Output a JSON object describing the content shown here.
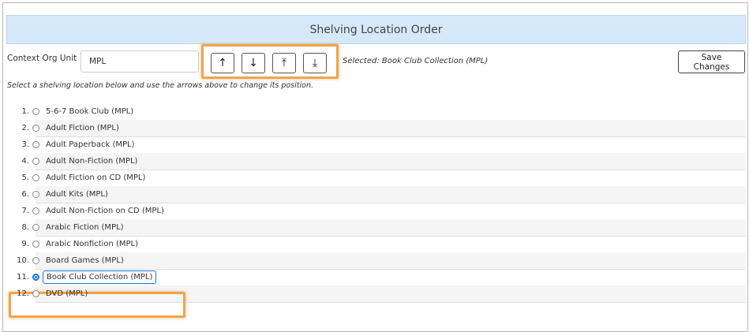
{
  "header": {
    "title": "Shelving Location Order"
  },
  "context": {
    "label": "Context Org Unit",
    "value": "MPL"
  },
  "arrows": [
    {
      "name": "move-up-icon",
      "glyph": "↑"
    },
    {
      "name": "move-down-icon",
      "glyph": "↓"
    },
    {
      "name": "move-to-top-icon",
      "glyph": "⤒"
    },
    {
      "name": "move-to-bottom-icon",
      "glyph": "⤓"
    }
  ],
  "selected_text": "Selected: Book Club Collection (MPL)",
  "save_label": "Save Changes",
  "instructions": "Select a shelving location below and use the arrows above to change its position.",
  "locations": [
    {
      "num": "1.",
      "label": "5-6-7 Book Club (MPL)",
      "checked": false
    },
    {
      "num": "2.",
      "label": "Adult Fiction (MPL)",
      "checked": false
    },
    {
      "num": "3.",
      "label": "Adult Paperback (MPL)",
      "checked": false
    },
    {
      "num": "4.",
      "label": "Adult Non-Fiction (MPL)",
      "checked": false
    },
    {
      "num": "5.",
      "label": "Adult Fiction on CD (MPL)",
      "checked": false
    },
    {
      "num": "6.",
      "label": "Adult Kits (MPL)",
      "checked": false
    },
    {
      "num": "7.",
      "label": "Adult Non-Fiction on CD (MPL)",
      "checked": false
    },
    {
      "num": "8.",
      "label": "Arabic Fiction (MPL)",
      "checked": false
    },
    {
      "num": "9.",
      "label": "Arabic Nonfiction (MPL)",
      "checked": false
    },
    {
      "num": "10.",
      "label": "Board Games (MPL)",
      "checked": false
    },
    {
      "num": "11.",
      "label": "Book Club Collection (MPL)",
      "checked": true
    },
    {
      "num": "12.",
      "label": "DVD (MPL)",
      "checked": false
    }
  ],
  "colors": {
    "header_bg": "#d6e9fa",
    "highlight": "#f0a54a",
    "accent": "#1a73e8"
  }
}
